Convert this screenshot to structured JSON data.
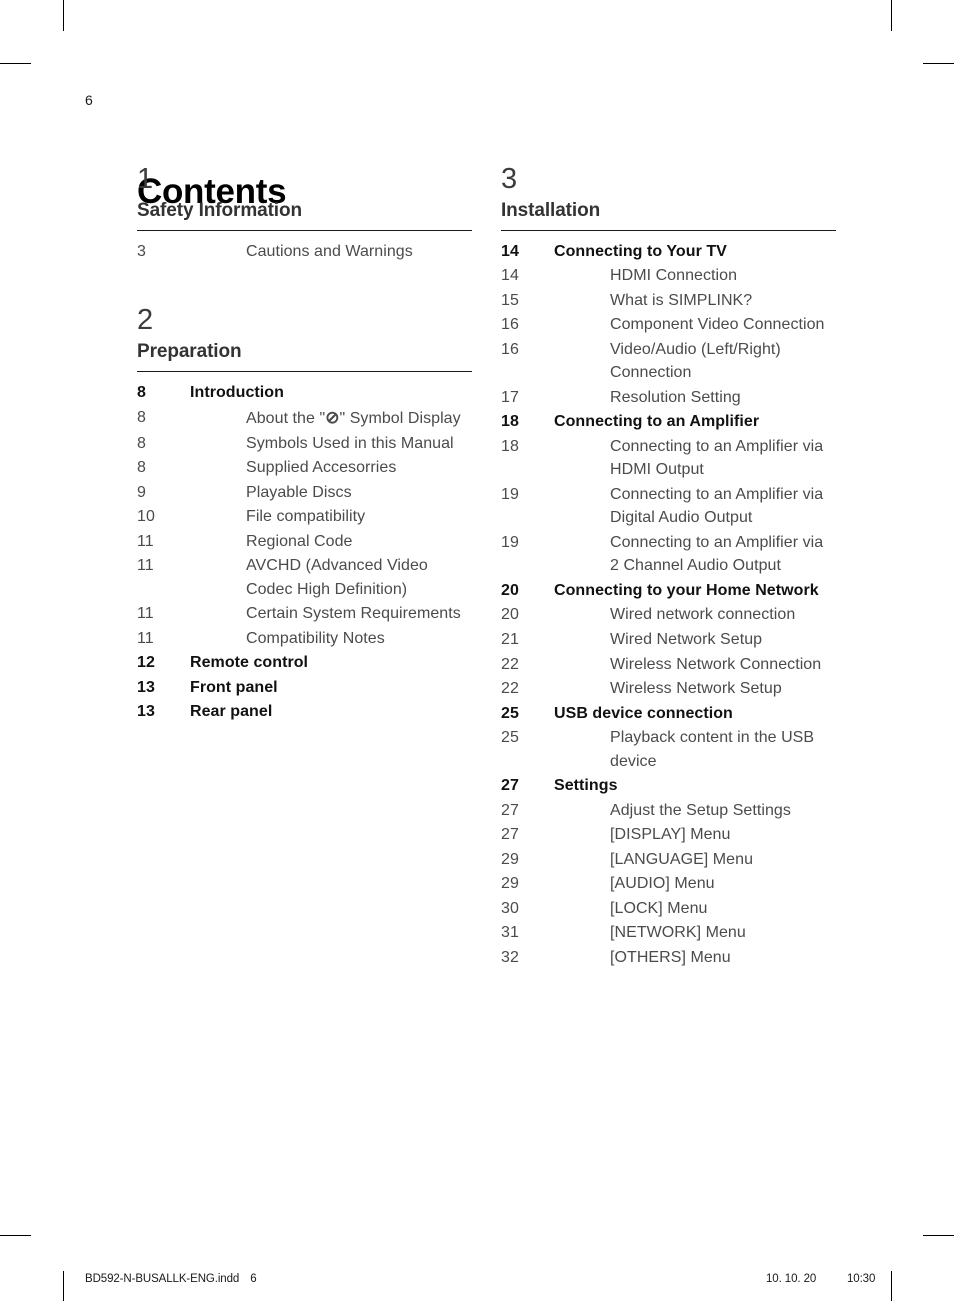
{
  "folio": "6",
  "title": "Contents",
  "footer": {
    "file": "BD592-N-BUSALLK-ENG.indd",
    "page": "6",
    "date": "10. 10. 20",
    "time": "10:30"
  },
  "columns": [
    {
      "sections": [
        {
          "number": "1",
          "name": "Safety Information",
          "entries": [
            {
              "page": "3",
              "label": "Cautions and Warnings",
              "level": 2
            }
          ]
        },
        {
          "number": "2",
          "name": "Preparation",
          "entries": [
            {
              "page": "8",
              "label": "Introduction",
              "level": 1
            },
            {
              "page": "8",
              "label": "About the \"⊘\" Symbol Display",
              "level": 2,
              "symbol": "no-entry-symbol"
            },
            {
              "page": "8",
              "label": "Symbols Used in this Manual",
              "level": 2
            },
            {
              "page": "8",
              "label": "Supplied Accesorries",
              "level": 2
            },
            {
              "page": "9",
              "label": "Playable Discs",
              "level": 2
            },
            {
              "page": "10",
              "label": "File compatibility",
              "level": 2
            },
            {
              "page": "11",
              "label": "Regional Code",
              "level": 2
            },
            {
              "page": "11",
              "label": "AVCHD (Advanced Video Codec High Definition)",
              "level": 2
            },
            {
              "page": "11",
              "label": "Certain System Requirements",
              "level": 2
            },
            {
              "page": "11",
              "label": "Compatibility Notes",
              "level": 2
            },
            {
              "page": "12",
              "label": "Remote control",
              "level": 1
            },
            {
              "page": "13",
              "label": "Front panel",
              "level": 1
            },
            {
              "page": "13",
              "label": "Rear panel",
              "level": 1
            }
          ]
        }
      ]
    },
    {
      "sections": [
        {
          "number": "3",
          "name": "Installation",
          "entries": [
            {
              "page": "14",
              "label": "Connecting to Your TV",
              "level": 1
            },
            {
              "page": "14",
              "label": "HDMI Connection",
              "level": 2
            },
            {
              "page": "15",
              "label": "What is SIMPLINK?",
              "level": 2
            },
            {
              "page": "16",
              "label": "Component Video Connection",
              "level": 2
            },
            {
              "page": "16",
              "label": "Video/Audio (Left/Right) Connection",
              "level": 2
            },
            {
              "page": "17",
              "label": "Resolution Setting",
              "level": 2
            },
            {
              "page": "18",
              "label": "Connecting to an Amplifier",
              "level": 1
            },
            {
              "page": "18",
              "label": "Connecting to an Amplifier via HDMI Output",
              "level": 2
            },
            {
              "page": "19",
              "label": "Connecting to an Amplifier via Digital Audio Output",
              "level": 2
            },
            {
              "page": "19",
              "label": "Connecting to an Amplifier via 2 Channel Audio Output",
              "level": 2
            },
            {
              "page": "20",
              "label": "Connecting to your Home Network",
              "level": 1
            },
            {
              "page": "20",
              "label": "Wired network connection",
              "level": 2
            },
            {
              "page": "21",
              "label": "Wired Network Setup",
              "level": 2
            },
            {
              "page": "22",
              "label": "Wireless Network Connection",
              "level": 2
            },
            {
              "page": "22",
              "label": "Wireless Network Setup",
              "level": 2
            },
            {
              "page": "25",
              "label": "USB device connection",
              "level": 1
            },
            {
              "page": "25",
              "label": "Playback content in the USB device",
              "level": 2
            },
            {
              "page": "27",
              "label": "Settings",
              "level": 1
            },
            {
              "page": "27",
              "label": "Adjust the Setup Settings",
              "level": 2
            },
            {
              "page": "27",
              "label": "[DISPLAY] Menu",
              "level": 2
            },
            {
              "page": "29",
              "label": "[LANGUAGE] Menu",
              "level": 2
            },
            {
              "page": "29",
              "label": "[AUDIO] Menu",
              "level": 2
            },
            {
              "page": "30",
              "label": "[LOCK] Menu",
              "level": 2
            },
            {
              "page": "31",
              "label": "[NETWORK] Menu",
              "level": 2
            },
            {
              "page": "32",
              "label": "[OTHERS] Menu",
              "level": 2
            }
          ]
        }
      ]
    }
  ]
}
